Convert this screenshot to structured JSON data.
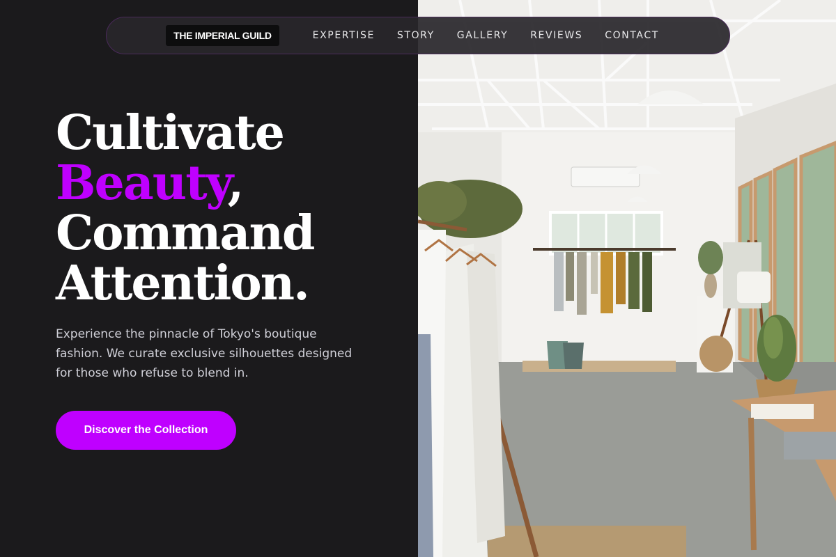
{
  "nav": {
    "brand": "THE IMPERIAL GUILD",
    "links": [
      "EXPERTISE",
      "STORY",
      "GALLERY",
      "REVIEWS",
      "CONTACT"
    ]
  },
  "hero": {
    "line1": "Cultivate",
    "line2_accent": "Beauty",
    "line2_punct": ",",
    "line3": "Command",
    "line4": "Attention.",
    "subtitle": "Experience the pinnacle of Tokyo's boutique fashion. We curate exclusive silhouettes designed for those who refuse to blend in.",
    "cta_label": "Discover the Collection"
  },
  "colors": {
    "accent": "#bf00ff",
    "background": "#1b1a1c"
  }
}
